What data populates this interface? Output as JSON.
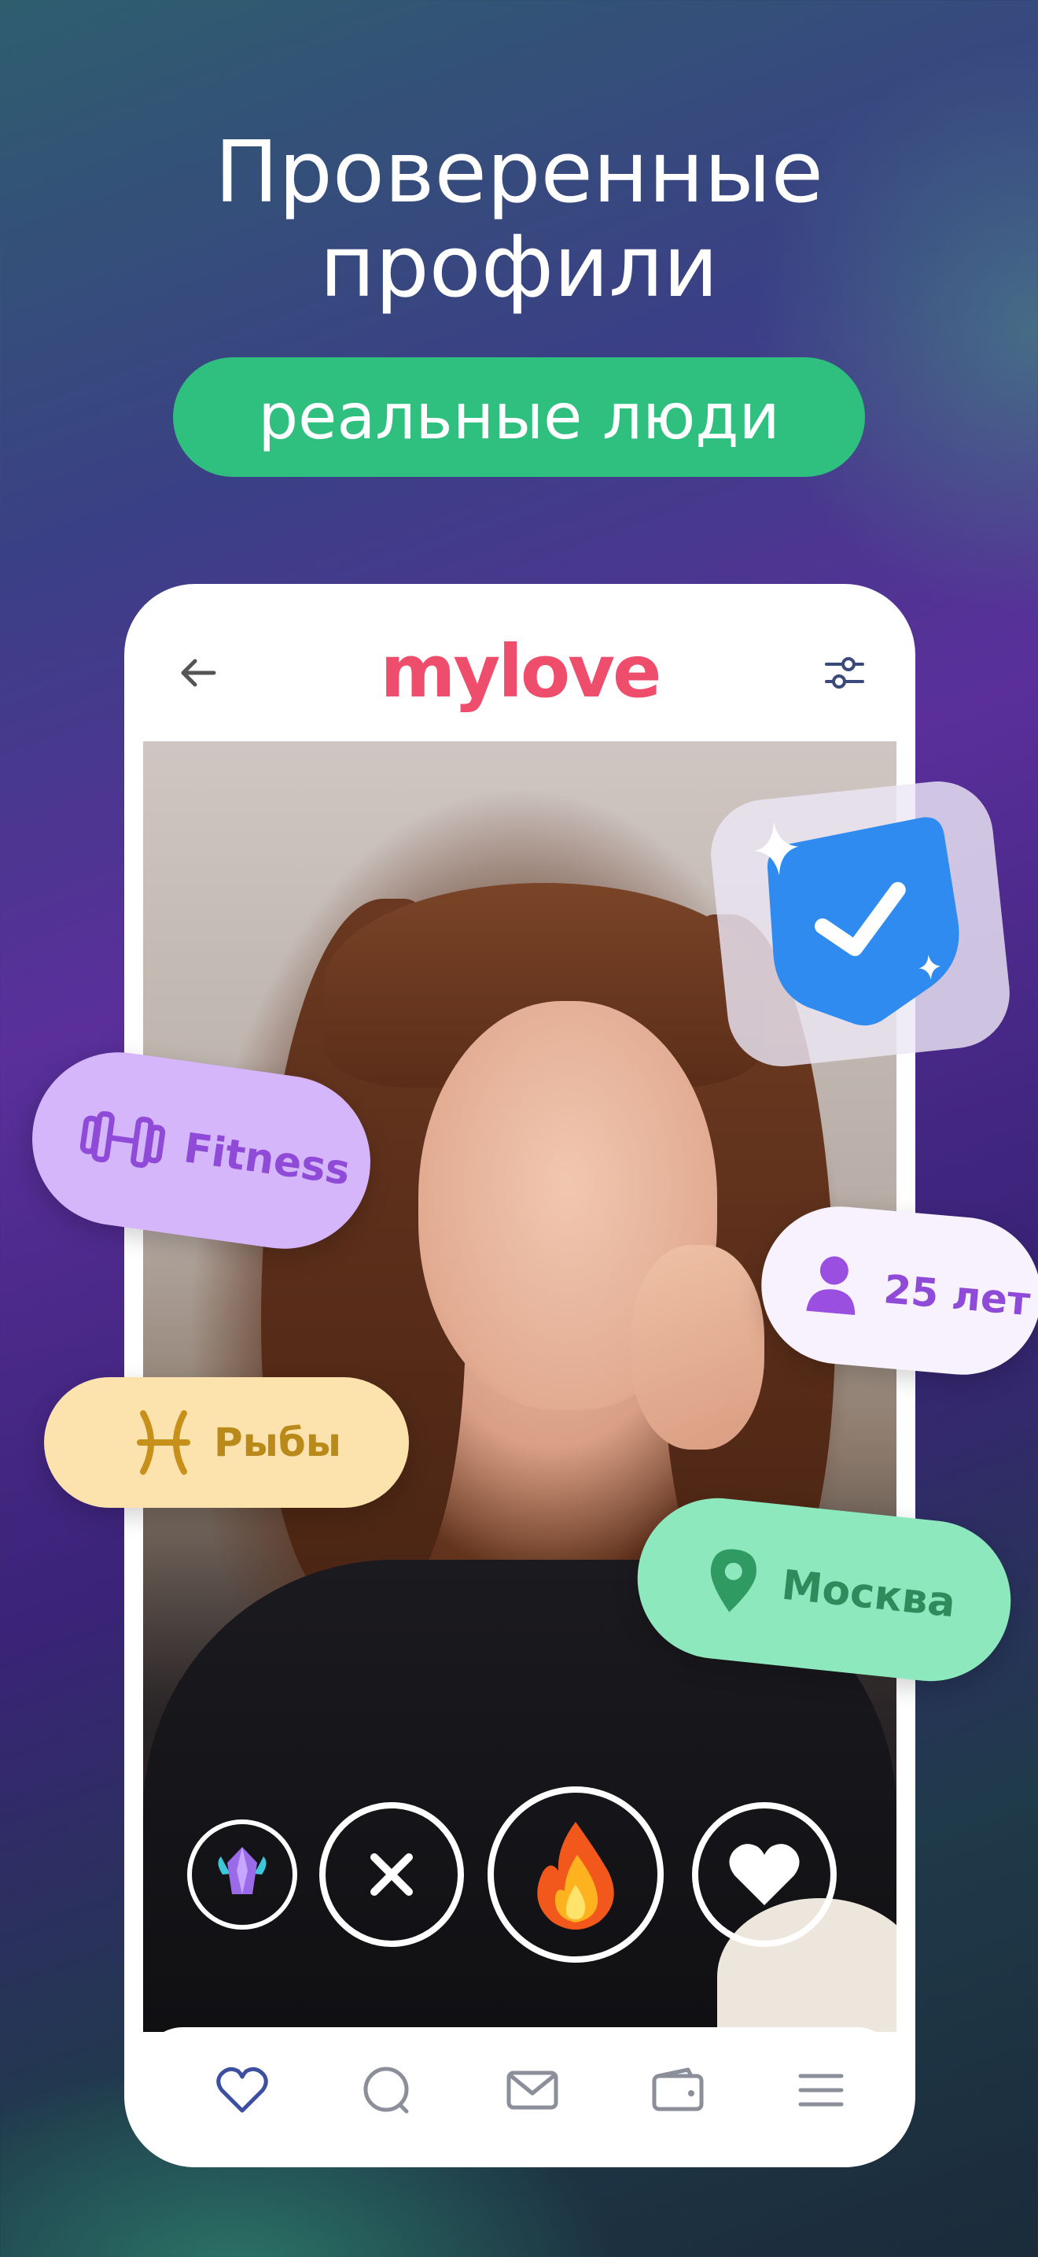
{
  "header": {
    "title_line1": "Проверенные",
    "title_line2": "профили",
    "tag": "реальные люди"
  },
  "app": {
    "logo": "mylove",
    "brand_color": "#ef4d6c"
  },
  "badges": {
    "interest": "Fitness",
    "age": "25 лет",
    "zodiac": "Рыбы",
    "city": "Москва"
  },
  "actions": [
    {
      "name": "boost",
      "icon": "gem-icon"
    },
    {
      "name": "dislike",
      "icon": "close-icon"
    },
    {
      "name": "superlike",
      "icon": "fire-icon"
    },
    {
      "name": "like",
      "icon": "heart-icon"
    }
  ],
  "bottom_nav": [
    {
      "name": "likes",
      "icon": "heart-outline-icon",
      "active": true
    },
    {
      "name": "search",
      "icon": "search-icon"
    },
    {
      "name": "messages",
      "icon": "mail-icon"
    },
    {
      "name": "wallet",
      "icon": "wallet-icon"
    },
    {
      "name": "menu",
      "icon": "menu-icon"
    }
  ],
  "colors": {
    "green": "#2fbf7f",
    "verified_blue": "#2f8bf0",
    "nav_active": "#3c4fa0"
  }
}
